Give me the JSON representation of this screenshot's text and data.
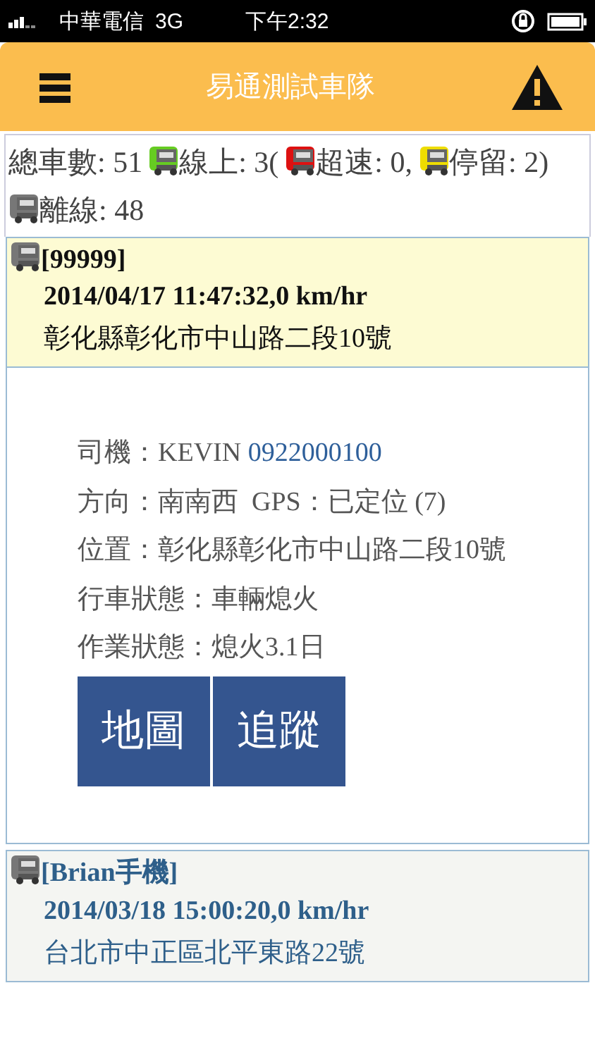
{
  "status_bar": {
    "carrier": "中華電信",
    "network": "3G",
    "time": "下午2:32"
  },
  "header": {
    "title": "易通測試車隊"
  },
  "summary": [
    {
      "text": "總車數: 51"
    },
    {
      "color": "#66cc22",
      "text": "線上: 3("
    },
    {
      "color": "#dd1111",
      "text": "超速: 0,"
    },
    {
      "color": "#eedd00",
      "text": "停留: 2)"
    },
    {
      "color": "#777777",
      "text": "離線: 48"
    }
  ],
  "vehicles": [
    {
      "name": "[99999]",
      "time_speed": "2014/04/17 11:47:32,0 km/hr",
      "address": "彰化縣彰化市中山路二段10號",
      "selected": true,
      "details": {
        "driver": "司機：KEVIN",
        "phone": "0922000100",
        "direction": "方向：南南西  GPS：已定位 (7)",
        "location": "位置：彰化縣彰化市中山路二段10號",
        "driving_status": "行車狀態：車輛熄火",
        "work_status": "作業狀態：熄火3.1日",
        "buttons": [
          "地圖",
          "追蹤"
        ]
      }
    },
    {
      "name": "[Brian手機]",
      "time_speed": "2014/03/18 15:00:20,0 km/hr",
      "address": "台北市中正區北平東路22號",
      "selected": false
    }
  ]
}
